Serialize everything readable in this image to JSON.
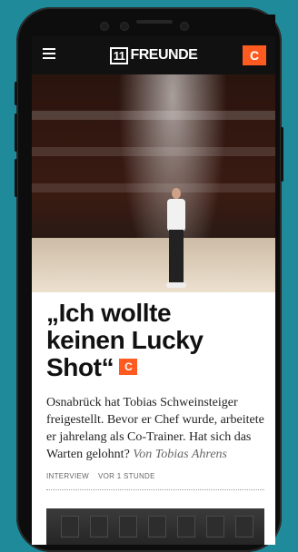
{
  "header": {
    "logo_box": "11",
    "logo_text": "FREUNDE",
    "badge": "C"
  },
  "article": {
    "headline_line1": "„Ich wollte",
    "headline_line2": "keinen Lucky",
    "headline_line3": "Shot“",
    "badge": "C",
    "teaser": "Osnabrück hat Tobias Schweinsteiger freigestellt. Bevor er Chef wurde, arbeitete er jahrelang als Co-Trainer. Hat sich das Warten gelohnt?",
    "author": "Von Tobias Ahrens",
    "category": "INTERVIEW",
    "time": "VOR 1 STUNDE"
  },
  "colors": {
    "accent": "#ff5a1f",
    "background": "#1f8a9a"
  },
  "icons": {
    "menu": "hamburger-menu-icon"
  }
}
